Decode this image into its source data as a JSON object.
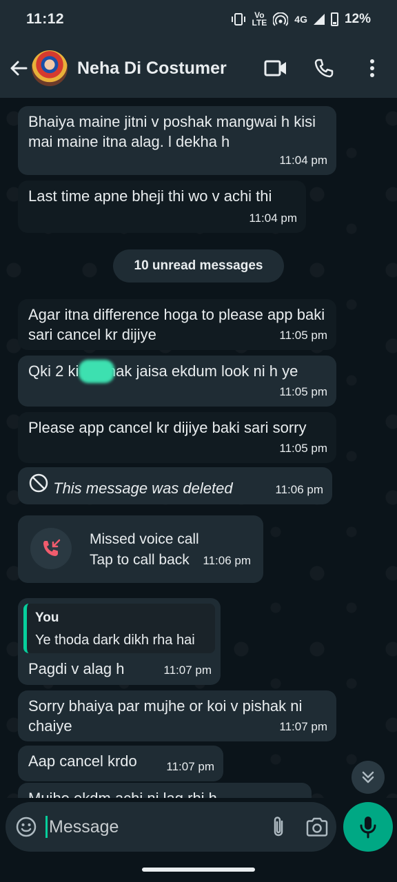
{
  "status_bar": {
    "time": "11:12",
    "volte_top": "Vo",
    "volte_bottom": "LTE",
    "network": "4G",
    "battery": "12%"
  },
  "header": {
    "contact_name": "Neha Di Costumer"
  },
  "messages": [
    {
      "text": "Bhaiya maine jitni v poshak mangwai h kisi mai maine itna alag. l dekha h",
      "time": "11:04 pm"
    },
    {
      "text": "Last time apne bheji thi wo v achi thi",
      "time": "11:04 pm"
    },
    {
      "text": "Agar itna difference hoga to please app baki sari cancel kr dijiye",
      "time": "11:05 pm"
    },
    {
      "text": "Qki 2     ki poshak jaisa ekdum look ni h ye",
      "time": "11:05 pm"
    },
    {
      "text": "Please app cancel kr dijiye baki sari sorry",
      "time": "11:05 pm"
    },
    {
      "text": "This message was deleted",
      "time": "11:06 pm"
    },
    {
      "text": "Pagdi v alag h",
      "time": "11:07 pm"
    },
    {
      "text": "Sorry bhaiya par mujhe or koi v pishak ni chaiye",
      "time": "11:07 pm"
    },
    {
      "text": "Aap cancel krdo",
      "time": "11:07 pm"
    },
    {
      "text": "Mujhe ekdm achi ni lag rhi h"
    }
  ],
  "unread_label": "10 unread messages",
  "missed_call": {
    "title": "Missed voice call",
    "subtitle": "Tap to call back",
    "time": "11:06 pm"
  },
  "quote": {
    "author": "You",
    "text": "Ye thoda dark dikh rha hai"
  },
  "composer": {
    "placeholder": "Message"
  },
  "colors": {
    "accent": "#00a884",
    "bubble": "#1f2c34",
    "background": "#0b141a",
    "missed_call_red": "#f15c6d"
  }
}
